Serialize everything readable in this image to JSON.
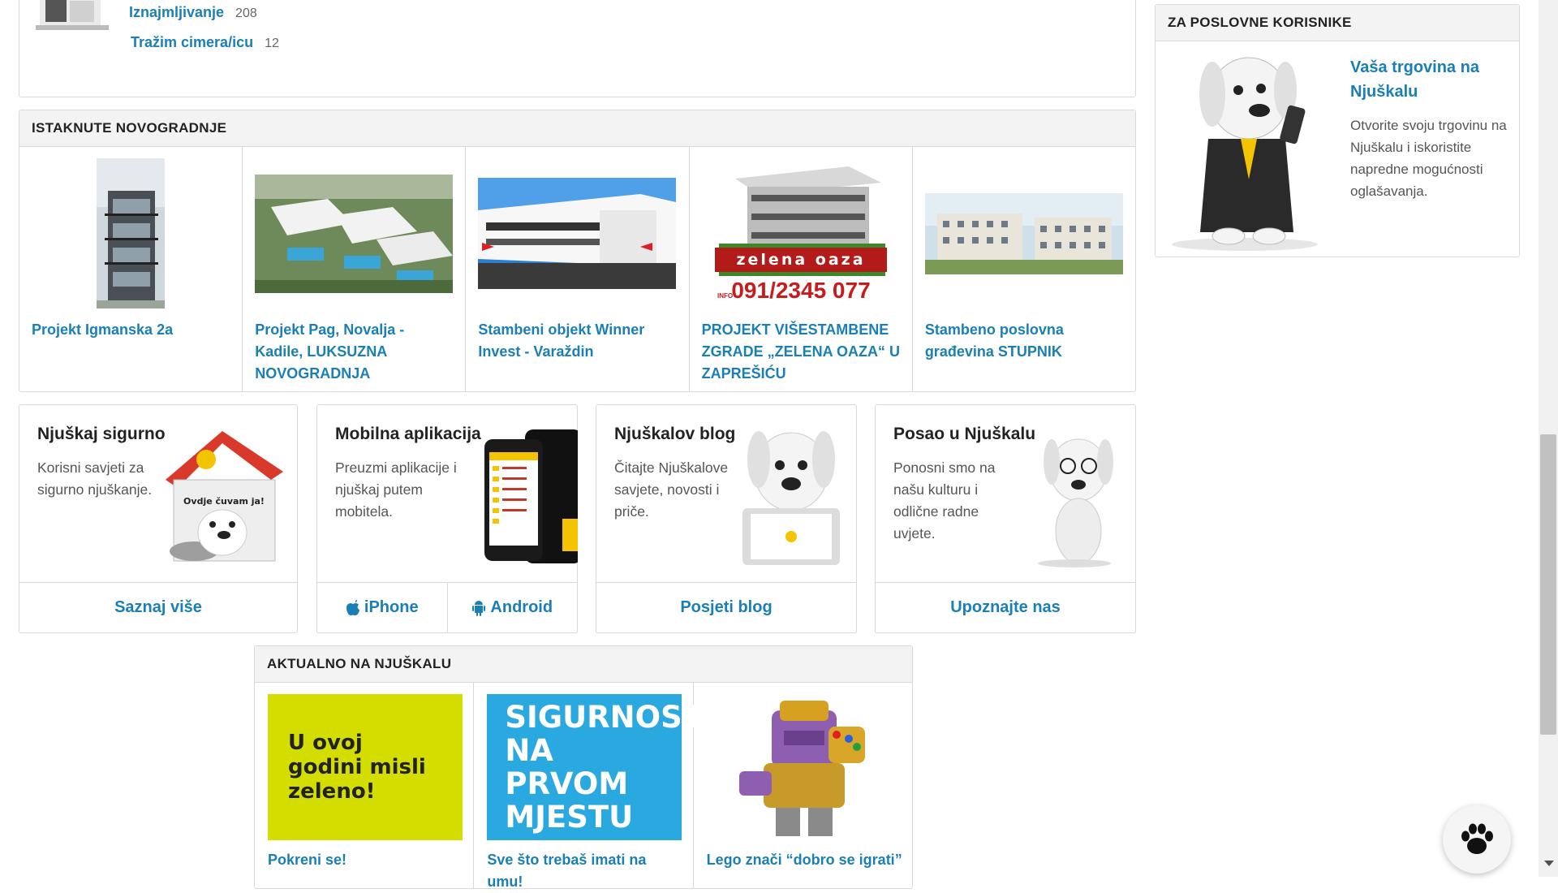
{
  "categories": [
    {
      "label": "Iznajmljivanje",
      "count": "208"
    },
    {
      "label": "Tražim cimera/icu",
      "count": "12"
    }
  ],
  "novogradnje": {
    "heading": "ISTAKNUTE NOVOGRADNJE",
    "items": [
      {
        "title": "Projekt Igmanska 2a"
      },
      {
        "title": "Projekt Pag, Novalja - Kadile, LUKSUZNA NOVOGRADNJA"
      },
      {
        "title": "Stambeni objekt Winner Invest - Varaždin"
      },
      {
        "title": "PROJEKT VIŠESTAMBENE ZGRADE „ZELENA OAZA“ U ZAPREŠIĆU",
        "img_text_1": "zelena oaza",
        "img_text_2": "091/2345 077",
        "img_text_3": "INFO"
      },
      {
        "title": "Stambeno poslovna građevina STUPNIK"
      }
    ]
  },
  "cards": [
    {
      "title": "Njuškaj sigurno",
      "text": "Korisni savjeti za sigurno njuškanje.",
      "links": [
        "Saznaj više"
      ],
      "sign": "Ovdje čuvam ja!"
    },
    {
      "title": "Mobilna aplikacija",
      "text": "Preuzmi aplikacije i njuškaj putem mobitela.",
      "links": [
        "iPhone",
        "Android"
      ]
    },
    {
      "title": "Njuškalov blog",
      "text": "Čitajte Njuškalove savjete, novosti i priče.",
      "links": [
        "Posjeti blog"
      ]
    },
    {
      "title": "Posao u Njuškalu",
      "text": "Ponosni smo na našu kulturu i odlične radne uvjete.",
      "links": [
        "Upoznajte nas"
      ]
    }
  ],
  "aktualno": {
    "heading": "AKTUALNO NA NJUŠKALU",
    "items": [
      {
        "caption": "Pokreni se!",
        "img_text": "U ovoj godini misli zeleno!",
        "img_bg": "#d4dd00"
      },
      {
        "caption": "Sve što trebaš imati na umu!",
        "img_text": "SIGURNOST NA PRVOM MJESTU",
        "img_bg": "#2aa9e0"
      },
      {
        "caption": "Lego znači “dobro se igrati”"
      }
    ]
  },
  "business": {
    "heading": "ZA POSLOVNE KORISNIKE",
    "title": "Vaša trgovina na Njuškalu",
    "text": "Otvorite svoju trgovinu na Njuškalu i iskoristite napredne mogućnosti oglašavanja."
  },
  "colors": {
    "link": "#1a7fb4",
    "border": "#d9d9d9",
    "header_bg": "#f3f3f3"
  },
  "icons": [
    "apple-icon",
    "android-icon",
    "paw-icon"
  ]
}
